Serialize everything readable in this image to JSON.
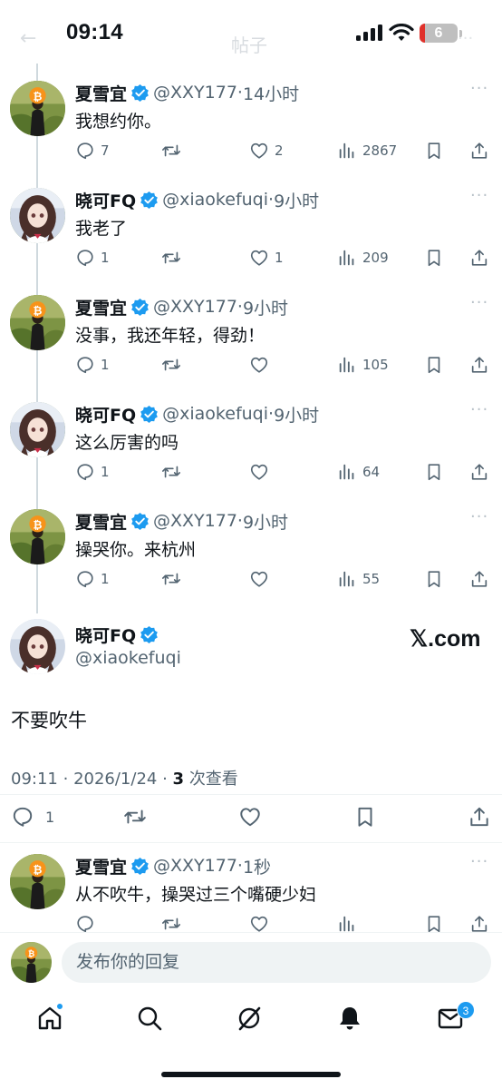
{
  "status_bar": {
    "time": "09:14",
    "battery_level": "6",
    "ghost_title": "帖子"
  },
  "colors": {
    "accent": "#1d9bf0",
    "text_primary": "#0f1419",
    "text_secondary": "#536471",
    "battery_low": "#e0312b"
  },
  "tweets": [
    {
      "name": "夏雪宜",
      "handle": "@XXY177",
      "time": "14小时",
      "text": "我想约你。",
      "replies": "7",
      "retweets": "",
      "likes": "2",
      "views": "2867",
      "avatar": "bitcoin-user"
    },
    {
      "name": "晓可FQ",
      "handle": "@xiaokefuqi",
      "time": "9小时",
      "text": "我老了",
      "replies": "1",
      "retweets": "",
      "likes": "1",
      "views": "209",
      "avatar": "anime-girl"
    },
    {
      "name": "夏雪宜",
      "handle": "@XXY177",
      "time": "9小时",
      "text": "没事，我还年轻，得劲！",
      "replies": "1",
      "retweets": "",
      "likes": "",
      "views": "105",
      "avatar": "bitcoin-user"
    },
    {
      "name": "晓可FQ",
      "handle": "@xiaokefuqi",
      "time": "9小时",
      "text": "这么厉害的吗",
      "replies": "1",
      "retweets": "",
      "likes": "",
      "views": "64",
      "avatar": "anime-girl"
    },
    {
      "name": "夏雪宜",
      "handle": "@XXY177",
      "time": "9小时",
      "text": "操哭你。来杭州",
      "replies": "1",
      "retweets": "",
      "likes": "",
      "views": "55",
      "avatar": "bitcoin-user"
    }
  ],
  "main_tweet": {
    "name": "晓可FQ",
    "handle": "@xiaokefuqi",
    "watermark": "𝕏.com",
    "text": "不要吹牛",
    "time": "09:11",
    "date": "2026/1/24",
    "views_count": "3",
    "views_label": "次查看",
    "replies": "1"
  },
  "reply_tweet": {
    "name": "夏雪宜",
    "handle": "@XXY177",
    "time": "1秒",
    "text": "从不吹牛，操哭过三个嘴硬少妇"
  },
  "reply_box": {
    "placeholder": "发布你的回复"
  },
  "tab_bar": {
    "items": [
      "home-icon",
      "search-icon",
      "grok-icon",
      "notifications-icon",
      "messages-icon"
    ],
    "messages_badge": "3"
  }
}
